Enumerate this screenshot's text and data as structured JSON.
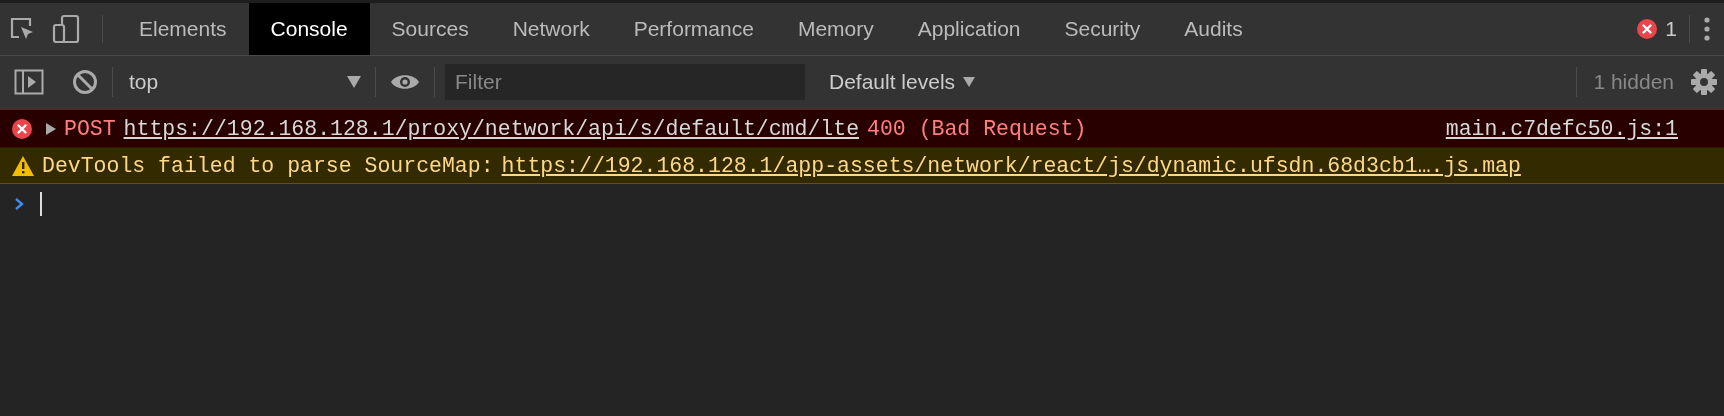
{
  "tabs": [
    {
      "label": "Elements",
      "selected": false
    },
    {
      "label": "Console",
      "selected": true
    },
    {
      "label": "Sources",
      "selected": false
    },
    {
      "label": "Network",
      "selected": false
    },
    {
      "label": "Performance",
      "selected": false
    },
    {
      "label": "Memory",
      "selected": false
    },
    {
      "label": "Application",
      "selected": false
    },
    {
      "label": "Security",
      "selected": false
    },
    {
      "label": "Audits",
      "selected": false
    }
  ],
  "error_count": "1",
  "toolbar": {
    "context": "top",
    "filter": {
      "placeholder": "Filter"
    },
    "levels": "Default levels",
    "hidden": "1 hidden"
  },
  "messages": [
    {
      "kind": "error",
      "method": "POST",
      "url": "https://192.168.128.1/proxy/network/api/s/default/cmd/lte",
      "status": "400 (Bad Request)",
      "source": "main.c7defc50.js:1"
    },
    {
      "kind": "warning",
      "text": "DevTools failed to parse SourceMap:",
      "url": "https://192.168.128.1/app-assets/network/react/js/dynamic.ufsdn.68d3cb1….js.map"
    }
  ]
}
